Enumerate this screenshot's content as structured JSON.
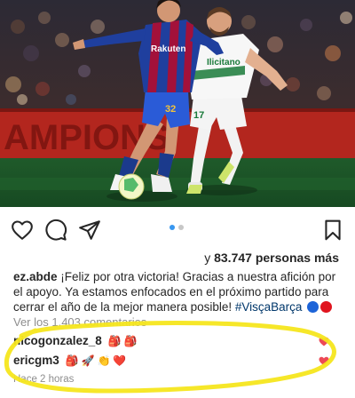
{
  "post": {
    "carousel_count": 2,
    "carousel_active": 1,
    "likes_prefix": "y ",
    "likes_count": "83.747",
    "likes_suffix": " personas más",
    "caption_user": "ez.abde",
    "caption_text": " ¡Feliz por otra victoria! Gracias a nuestra afición por el apoyo. Ya estamos enfocados en el próximo partido para cerrar el año de la mejor manera posible! ",
    "caption_hashtag": "#VisçaBarça",
    "view_all": "Ver los 1.403 comentarios",
    "timestamp": "Hace 2 horas"
  },
  "photo": {
    "barca_sponsor": "Rakuten",
    "barca_number": "32",
    "elche_sponsor": "Ilicitano",
    "elche_number": "17",
    "ad_board_text": "AMPIONS"
  },
  "comments": [
    {
      "user": "nicogonzalez_8",
      "emojis": [
        "🎒",
        "🎒"
      ]
    },
    {
      "user": "ericgm3",
      "emojis": [
        "🎒",
        "🚀",
        "👏",
        "❤️"
      ]
    }
  ],
  "icons": [
    "heart-icon",
    "comment-icon",
    "share-icon",
    "bookmark-icon"
  ],
  "colors": {
    "like_heart": "#ed4956",
    "highlight_stroke": "#f5e61e",
    "dot_active": "#3897f0",
    "dot_inactive": "#c7c7c7",
    "blue_circle": "#1d64d8",
    "red_circle": "#e0141e"
  }
}
